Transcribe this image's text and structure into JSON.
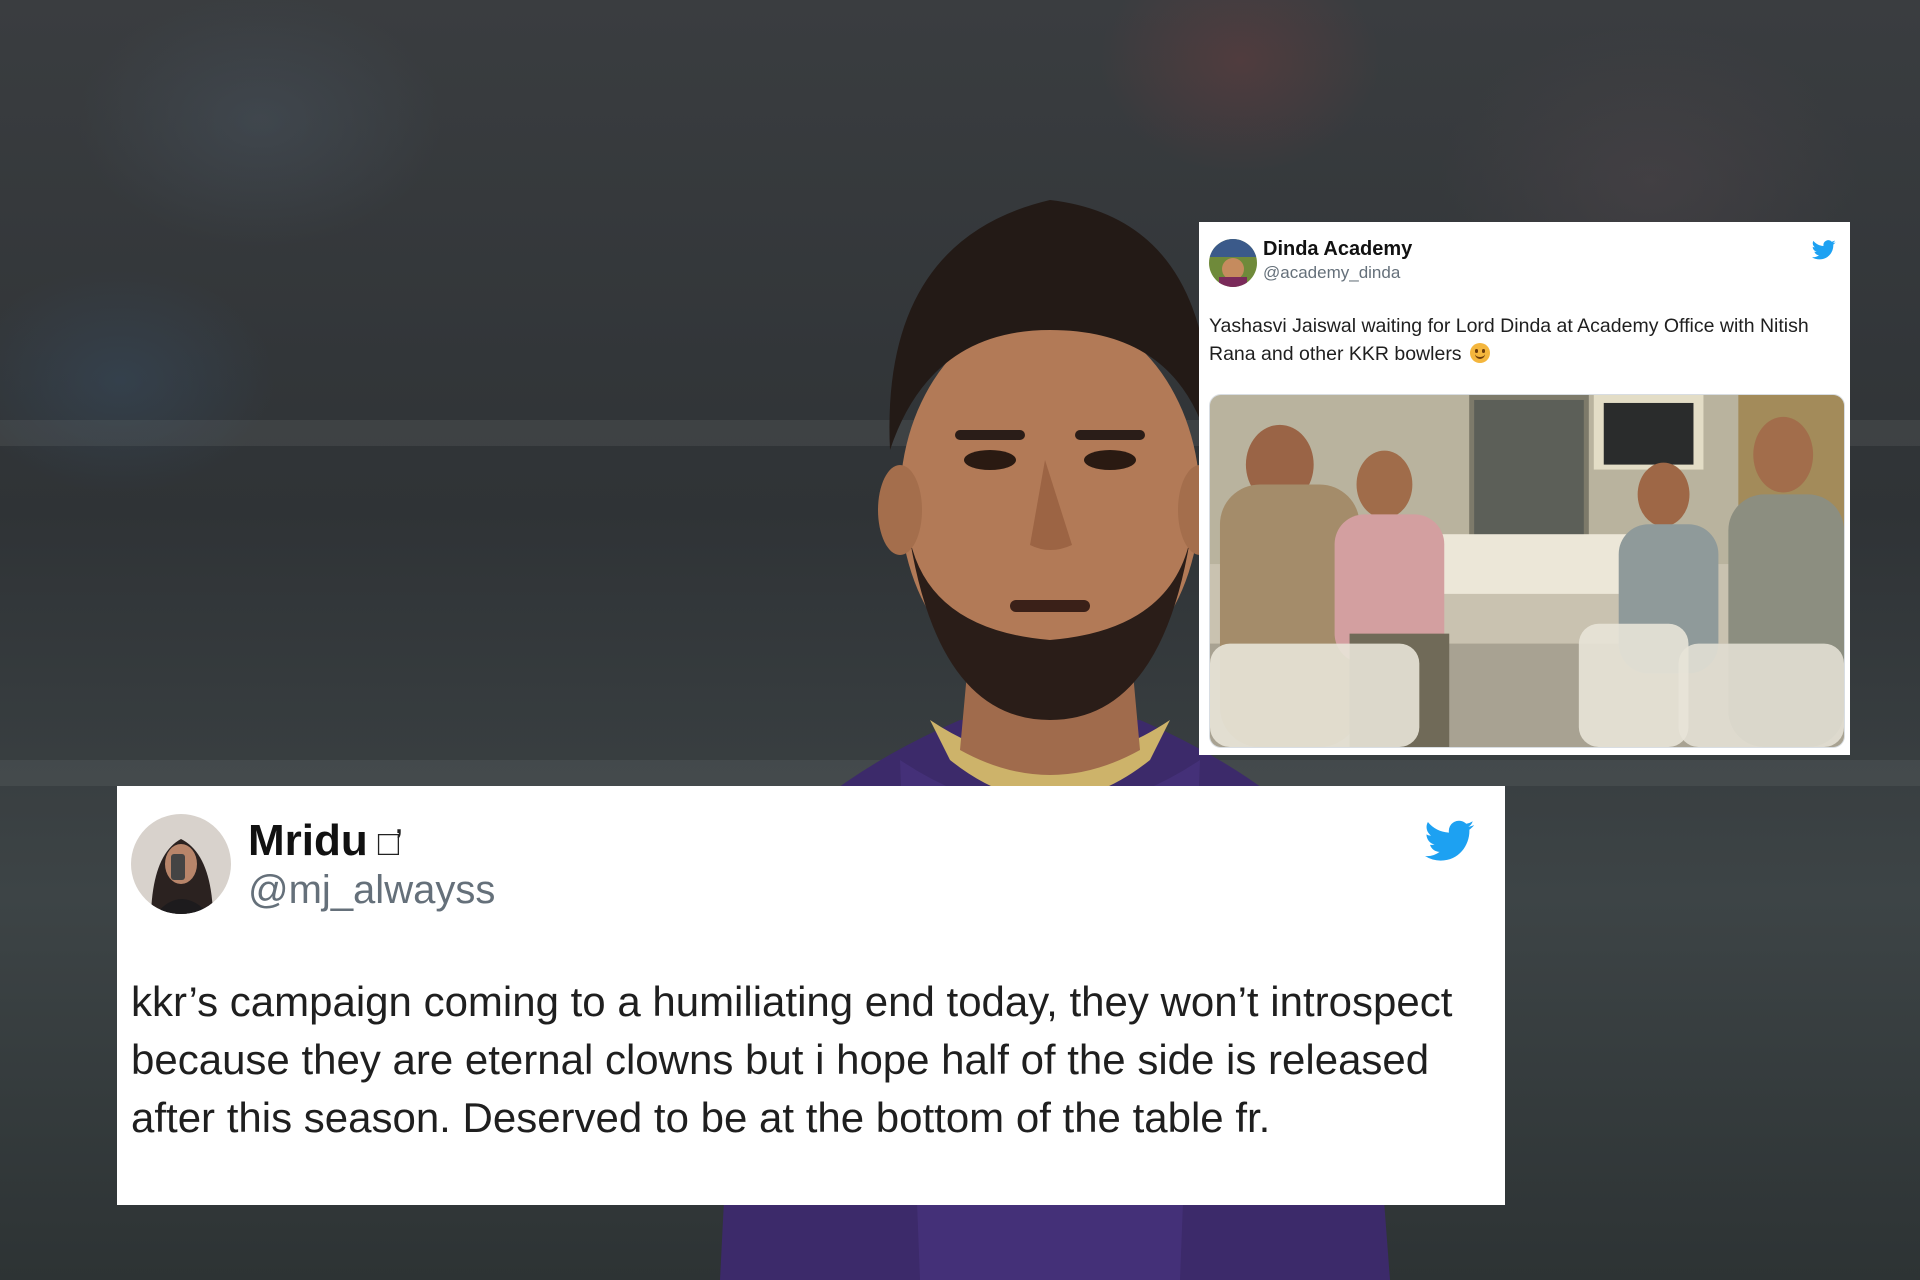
{
  "background": {
    "description_icon": "cricketer-photo",
    "jersey_color": "#3c2a6a"
  },
  "tweet_top": {
    "name": "Dinda Academy",
    "handle": "@academy_dinda",
    "text": "Yashasvi Jaiswal waiting for Lord Dinda at Academy Office with Nitish Rana and other KKR bowlers",
    "emoji_icon": "smiling-face-emoji",
    "bird_icon": "twitter-bird-icon",
    "bird_color": "#1da1f2",
    "image_icon": "meme-photo-office"
  },
  "tweet_bottom": {
    "name": "Mridu",
    "name_suffix": "□̓",
    "handle": "@mj_alwayss",
    "text": "kkr’s campaign coming to a humiliating end today, they won’t introspect because they are eternal clowns but i hope half of the side is released after this season. Deserved to be at the bottom of the table fr.",
    "bird_icon": "twitter-bird-icon",
    "bird_color": "#1da1f2"
  }
}
